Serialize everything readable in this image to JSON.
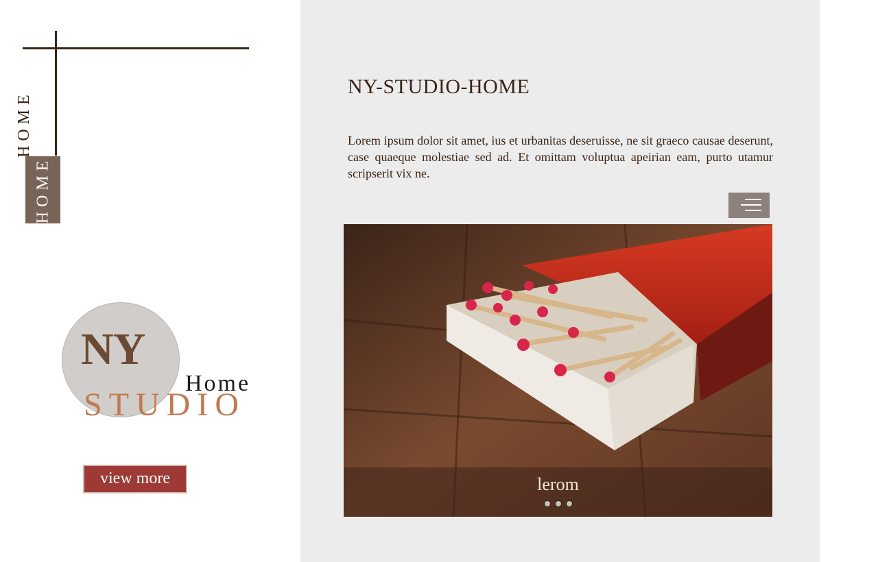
{
  "sidebar": {
    "vertical_label_outline": "HOME",
    "vertical_label_box": "HOME"
  },
  "logo": {
    "ny": "NY",
    "home": "Home",
    "studio": "STUDIO"
  },
  "cta": {
    "label": "view more"
  },
  "main": {
    "title": "NY-STUDIO-HOME",
    "intro": "Lorem ipsum dolor sit amet, ius et urbanitas deseruisse, ne sit graeco causae deserunt, case quaeque molestiae sed ad. Et omittam voluptua apeirian eam, purto utamur scripserit vix ne."
  },
  "menu": {
    "icon": "hamburger-menu-icon"
  },
  "slider": {
    "caption": "lerom",
    "dots_count": 3,
    "image": "matchbox-photo"
  },
  "colors": {
    "accent": "#9e3a36",
    "brown": "#3b2417",
    "studio": "#c07a52",
    "box": "#786558",
    "panel": "#ececec"
  }
}
